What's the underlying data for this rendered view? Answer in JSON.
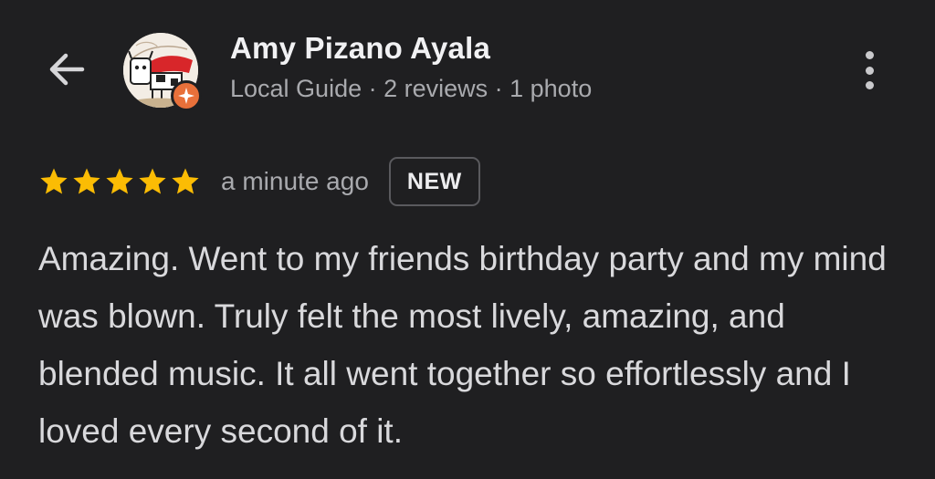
{
  "header": {
    "back_icon": "arrow-left-icon",
    "user_name": "Amy Pizano Ayala",
    "user_meta": "Local Guide · 2 reviews · 1 photo",
    "avatar_icon": "cow-drawing-avatar",
    "badge_icon": "local-guide-star-icon",
    "more_icon": "more-vertical-icon"
  },
  "review": {
    "rating": 5,
    "max_rating": 5,
    "time": "a minute ago",
    "badge": "NEW",
    "text": "Amazing. Went to my friends birthday party and my mind was blown. Truly felt the most lively, amazing, and blended music. It all went together so effortlessly and I loved every second of it."
  },
  "colors": {
    "background": "#1f1f21",
    "star": "#fbbc04",
    "guide_badge": "#e8703a",
    "meta_text": "#a9aaae"
  }
}
